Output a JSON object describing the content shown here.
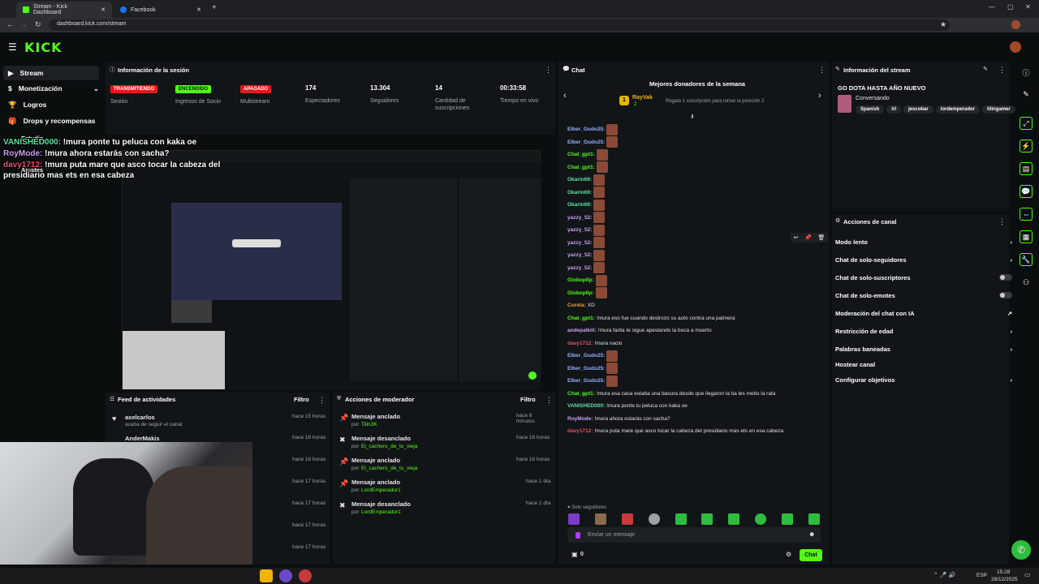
{
  "browser": {
    "tabs": [
      {
        "title": "Stream - Kick Dashboard",
        "icon": "kick-icon"
      },
      {
        "title": "Facebook",
        "icon": "facebook-icon"
      }
    ],
    "url": "dashboard.kick.com/stream"
  },
  "app": {
    "logo": "KICK"
  },
  "sidebar": {
    "items": [
      {
        "label": "Stream"
      },
      {
        "label": "Monetización"
      },
      {
        "label": "Logros"
      },
      {
        "label": "Drops y recompensas"
      },
      {
        "label": "Estudio"
      },
      {
        "label": "Canal"
      },
      {
        "label": "Ajustes"
      }
    ]
  },
  "stream_info_panel": {
    "title": "Información de la sesión",
    "stats": [
      {
        "badge": "TRANSMITIENDO",
        "label": "Sesión",
        "badge_color": "#e21b1b"
      },
      {
        "badge": "ENCENDIDO",
        "label": "Ingresos de Socio",
        "badge_color": "#53fc18"
      },
      {
        "badge": "APAGADO",
        "label": "Multistream",
        "badge_color": "#e21b1b"
      },
      {
        "value": "174",
        "label": "Espectadores"
      },
      {
        "value": "13.304",
        "label": "Seguidores"
      },
      {
        "value": "14",
        "label": "Cantidad de suscripciones"
      },
      {
        "value": "00:33:58",
        "label": "Tiempo en vivo"
      }
    ]
  },
  "overlay_chat": [
    {
      "user": "VANISHED000:",
      "msg": " !mura ponte tu peluca con kaka oe",
      "color": "#5be3a0"
    },
    {
      "user": "RoyMode:",
      "msg": " !mura ahora estarás con sacha?",
      "color": "#c9a0f0"
    },
    {
      "user": "davy1712:",
      "msg": " !mura puta mare que asco tocar la cabeza del",
      "color": "#e0556a"
    },
    {
      "user": "",
      "msg": "presidiario mas ets en esa cabeza",
      "color": "#ffffff"
    }
  ],
  "activity_feed": {
    "title": "Feed de actividades",
    "filter": "Filtro",
    "items": [
      {
        "name": "axelcarlos",
        "sub": "acaba de seguir el canal",
        "time": "hace 15 horas"
      },
      {
        "name": "AnderMakis",
        "sub": "",
        "time": "hace 16 horas"
      },
      {
        "name": "",
        "sub": "",
        "time": "hace 16 horas"
      },
      {
        "name": "",
        "sub": "",
        "time": "hace 17 horas"
      },
      {
        "name": "",
        "sub": "",
        "time": "hace 17 horas"
      },
      {
        "name": "",
        "sub": "",
        "time": "hace 17 horas"
      },
      {
        "name": "",
        "sub": "",
        "time": "hace 17 horas"
      }
    ]
  },
  "mod_actions": {
    "title": "Acciones de moderador",
    "filter": "Filtro",
    "items": [
      {
        "action": "Mensaje anclado",
        "by": "por",
        "user": "Tilin3K",
        "time": "hace 8 minutos"
      },
      {
        "action": "Mensaje desanclado",
        "by": "por",
        "user": "El_cachero_de_tu_vieja",
        "time": "hace 16 horas"
      },
      {
        "action": "Mensaje anclado",
        "by": "por",
        "user": "El_cachero_de_tu_vieja",
        "time": "hace 16 horas"
      },
      {
        "action": "Mensaje anclado",
        "by": "por",
        "user": "LordEmperador1",
        "time": "hace 1 día"
      },
      {
        "action": "Mensaje desanclado",
        "by": "por",
        "user": "LordEmperador1",
        "time": "hace 1 día"
      }
    ]
  },
  "chat": {
    "title": "Chat",
    "top_donors_title": "Mejores donadores de la semana",
    "donor_rank": "1",
    "donor_name": "RayVak",
    "donor_count": "2",
    "gift_text": "Regala 1 suscripción para tomar la posición 2",
    "messages": [
      {
        "user": "Elber_Gudo25:",
        "text": "",
        "emote": true,
        "color": "#8fb3ff"
      },
      {
        "user": "Elber_Gudo25:",
        "text": "",
        "emote": true,
        "color": "#8fb3ff"
      },
      {
        "user": "Chat_gpt1:",
        "text": "",
        "emote": true,
        "color": "#53fc18"
      },
      {
        "user": "Chat_gpt1:",
        "text": "",
        "emote": true,
        "color": "#53fc18"
      },
      {
        "user": "Okarin69:",
        "text": "",
        "emote": true,
        "color": "#5be3a0"
      },
      {
        "user": "Okarin69:",
        "text": "",
        "emote": true,
        "color": "#5be3a0"
      },
      {
        "user": "Okarin69:",
        "text": "",
        "emote": true,
        "color": "#5be3a0"
      },
      {
        "user": "yazzy_52:",
        "text": "",
        "emote": true,
        "color": "#c9a0f0"
      },
      {
        "user": "yazzy_52:",
        "text": "",
        "emote": true,
        "color": "#c9a0f0"
      },
      {
        "user": "yazzy_52:",
        "text": "",
        "emote": true,
        "color": "#c9a0f0"
      },
      {
        "user": "yazzy_52:",
        "text": "",
        "emote": true,
        "color": "#c9a0f0"
      },
      {
        "user": "yazzy_52:",
        "text": "",
        "emote": true,
        "color": "#c9a0f0"
      },
      {
        "user": "Globop0p:",
        "text": "",
        "emote": true,
        "color": "#53fc18"
      },
      {
        "user": "Globop0p:",
        "text": "",
        "emote": true,
        "color": "#53fc18"
      },
      {
        "user": "Cureta:",
        "text": " XD",
        "emote": false,
        "color": "#f0a030"
      },
      {
        "user": "Chat_gpt1:",
        "text": " !mura eso fue cuando destrozo su auto contra una palmera",
        "emote": false,
        "color": "#53fc18"
      },
      {
        "user": "andepalkili:",
        "text": " !mura farita te sigue apestando la boca a muerto",
        "emote": false,
        "color": "#c9a0f0"
      },
      {
        "user": "davy1712:",
        "text": " !mura nacio",
        "emote": false,
        "color": "#e0556a"
      },
      {
        "user": "Elber_Gudo25:",
        "text": "",
        "emote": true,
        "color": "#8fb3ff"
      },
      {
        "user": "Elber_Gudo25:",
        "text": "",
        "emote": true,
        "color": "#8fb3ff"
      },
      {
        "user": "Elber_Gudo25:",
        "text": "",
        "emote": true,
        "color": "#8fb3ff"
      },
      {
        "user": "Chat_gpt1:",
        "text": " !mura esa casa estaba una basura desde que llegaron la tia les metio la rata",
        "emote": false,
        "color": "#53fc18"
      },
      {
        "user": "VANISHED000:",
        "text": " !mura ponte tu peluca con kaka oe",
        "emote": false,
        "color": "#5be3a0"
      },
      {
        "user": "RoyMode:",
        "text": " !mura ahora estarás con sacha?",
        "emote": false,
        "color": "#c9a0f0"
      },
      {
        "user": "davy1712:",
        "text": " !mura puta mare que asco tocar la cabeza del presidiario mas ets en esa cabeza",
        "emote": false,
        "color": "#e0556a"
      }
    ],
    "followers_only": "Solo seguidores",
    "input_placeholder": "Enviar un mensaje",
    "points": "0",
    "send_label": "Chat"
  },
  "stream_details": {
    "title": "Información del stream",
    "stream_title": "GO DOTA HASTA AÑO NUEVO",
    "category": "Conversando",
    "tags": [
      "Spanish",
      "irl",
      "jescobar",
      "lordemperador",
      "tilingamer"
    ]
  },
  "channel_actions": {
    "title": "Acciones de canal",
    "items": [
      {
        "label": "Modo lento",
        "control": "chevron"
      },
      {
        "label": "Chat de solo-seguidores",
        "control": "chevron"
      },
      {
        "label": "Chat de solo-suscriptores",
        "control": "toggle"
      },
      {
        "label": "Chat de solo-emotes",
        "control": "toggle"
      },
      {
        "label": "Moderación del chat con IA",
        "control": "external"
      },
      {
        "label": "Restricción de edad",
        "control": "chevron"
      },
      {
        "label": "Palabras baneadas",
        "control": "chevron"
      },
      {
        "label": "Hostear canal",
        "control": "none"
      },
      {
        "label": "Configurar objetivos",
        "control": "chevron"
      }
    ]
  },
  "taskbar": {
    "lang": "ESP",
    "time": "15:28",
    "date": "28/12/2025"
  },
  "colors": {
    "accent": "#53fc18",
    "live_red": "#e21b1b",
    "panel": "#121518",
    "bg": "#0b0e0f"
  }
}
